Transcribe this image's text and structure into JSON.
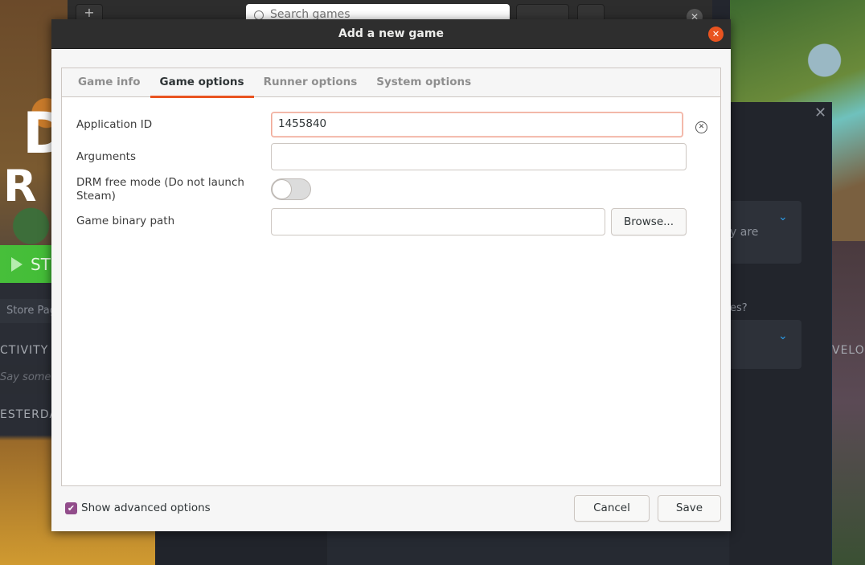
{
  "background": {
    "steam": {
      "game_title_letters": [
        "D",
        "R"
      ],
      "play_button": "ST",
      "store_page": "Store Pag",
      "activity": "CTIVITY",
      "say_something": "Say someth",
      "yesterday": "ESTERDA",
      "right_text_1": "y are",
      "right_text_2": "es?",
      "velo": "VELO"
    },
    "lutris": {
      "add_icon": "+",
      "search_placeholder": "Search games",
      "close_icon": "✕"
    }
  },
  "dialog": {
    "title": "Add a new game",
    "close_icon": "✕",
    "tabs": [
      {
        "label": "Game info",
        "active": false
      },
      {
        "label": "Game options",
        "active": true
      },
      {
        "label": "Runner options",
        "active": false
      },
      {
        "label": "System options",
        "active": false
      }
    ],
    "fields": {
      "application_id": {
        "label": "Application ID",
        "value": "1455840"
      },
      "arguments": {
        "label": "Arguments",
        "value": ""
      },
      "drm_free": {
        "label": "DRM free mode (Do not launch Steam)",
        "enabled": false
      },
      "game_binary_path": {
        "label": "Game binary path",
        "value": ""
      }
    },
    "clear_icon": "✕",
    "browse_label": "Browse...",
    "show_advanced": {
      "label": "Show advanced options",
      "checked": true
    },
    "cancel_label": "Cancel",
    "save_label": "Save"
  },
  "colors": {
    "accent": "#e95420",
    "checkbox": "#924d8b",
    "steam_play": "#47bf3a",
    "steam_chevron": "#2b9ce8"
  }
}
